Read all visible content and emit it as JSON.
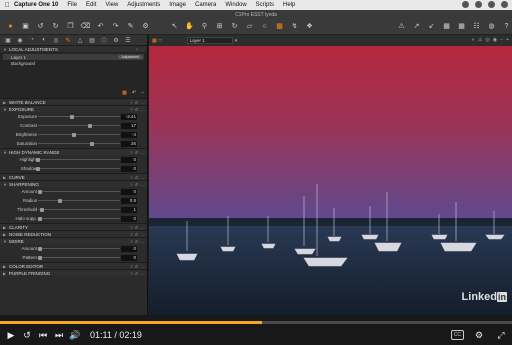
{
  "menubar": {
    "apple": "",
    "items": [
      "Capture One 10",
      "File",
      "Edit",
      "View",
      "Adjustments",
      "Image",
      "Camera",
      "Window",
      "Scripts",
      "Help"
    ]
  },
  "window": {
    "title": "C1Pro ESST lynda"
  },
  "panel": {
    "local_adjustments": "LOCAL ADJUSTMENTS",
    "layers": [
      {
        "name": "Layer 1",
        "badge": "Adjustment"
      },
      {
        "name": "Background",
        "badge": ""
      }
    ],
    "sections": {
      "white_balance": "WHITE BALANCE",
      "exposure": "EXPOSURE",
      "hdr": "HIGH DYNAMIC RANGE",
      "curve": "CURVE",
      "sharpening": "SHARPENING",
      "clarity": "CLARITY",
      "noise": "NOISE REDUCTION",
      "moire": "MOIRE",
      "color_editor": "COLOR EDITOR",
      "purple": "PURPLE FRINGING"
    },
    "exposure": [
      {
        "label": "Exposure",
        "value": "-2.41"
      },
      {
        "label": "Contrast",
        "value": "17"
      },
      {
        "label": "Brightness",
        "value": "-4"
      },
      {
        "label": "Saturation",
        "value": "26"
      }
    ],
    "hdr": [
      {
        "label": "Highlight",
        "value": "0"
      },
      {
        "label": "Shadow",
        "value": "0"
      }
    ],
    "sharpening": [
      {
        "label": "Amount",
        "value": "0"
      },
      {
        "label": "Radius",
        "value": "0.8"
      },
      {
        "label": "Threshold",
        "value": "1"
      },
      {
        "label": "Halo supp.",
        "value": "0"
      }
    ],
    "moire": [
      {
        "label": "Amount",
        "value": "0"
      },
      {
        "label": "Pattern",
        "value": "0"
      }
    ]
  },
  "viewer": {
    "layer_select": "Layer 1"
  },
  "watermark": {
    "text": "Linked",
    "in": "in"
  },
  "controls": {
    "current_time": "01:11",
    "separator": "/",
    "total_time": "02:19",
    "progress": 0.512,
    "cc_label": "CC"
  },
  "colors": {
    "accent": "#f28a1a",
    "progress": "#f5a623",
    "sky_top": "#b4283c",
    "sky_bottom": "#5a4b92",
    "water": "#1d2a3a"
  }
}
